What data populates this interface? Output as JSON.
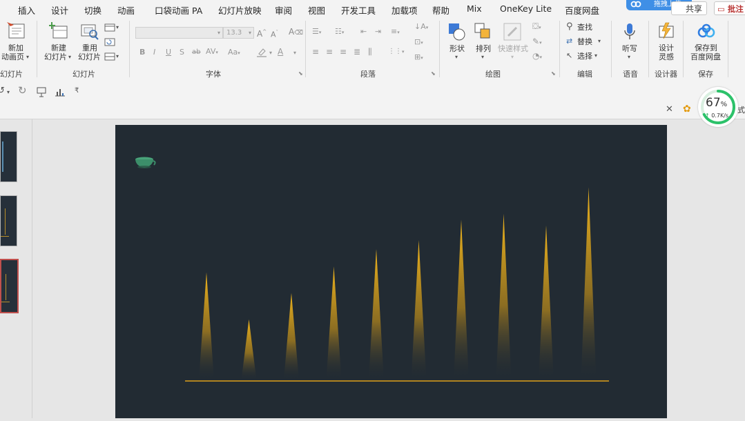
{
  "menu": {
    "tabs": [
      "插入",
      "设计",
      "切换",
      "动画",
      "口袋动画 PA",
      "幻灯片放映",
      "审阅",
      "视图",
      "开发工具",
      "加载项",
      "帮助",
      "Mix",
      "OneKey Lite",
      "百度网盘"
    ],
    "upload_label": "拖拽上传",
    "share_label": "共享",
    "comment_label": "批注"
  },
  "ribbon": {
    "new_animation_page": [
      "新加",
      "动画页"
    ],
    "new_slide": [
      "新建",
      "幻灯片"
    ],
    "reuse_slide": [
      "重用",
      "幻灯片"
    ],
    "font_size_value": "13.3",
    "shape_label": "形状",
    "arrange_label": "排列",
    "quick_style_label": "快速样式",
    "find_label": "查找",
    "replace_label": "替换",
    "select_label": "选择",
    "dictate_label": "听写",
    "design_ideas": [
      "设计",
      "灵感"
    ],
    "save_to_baidu": [
      "保存到",
      "百度网盘"
    ],
    "groups": {
      "slides_partial": "幻灯片",
      "slides": "幻灯片",
      "font": "字体",
      "paragraph": "段落",
      "drawing": "绘图",
      "editing": "编辑",
      "voice": "语音",
      "designer": "设计器",
      "save": "保存"
    },
    "format_buttons": [
      "B",
      "I",
      "U",
      "S"
    ]
  },
  "tabstrip": {
    "partial_label": "式"
  },
  "speed_widget": {
    "percent": "67",
    "percent_sign": "%",
    "rate": "0.7K/s",
    "rate_arrow": "↑",
    "ratio": 0.67
  },
  "slide": {
    "background": "#222b33",
    "spike_color": "#f0b21c",
    "baseline_color": "#e0a11b",
    "spike_heights": [
      0.37,
      0.21,
      0.3,
      0.39,
      0.45,
      0.48,
      0.55,
      0.57,
      0.53,
      0.66
    ]
  },
  "icons": {
    "cup": "teacup-icon"
  }
}
